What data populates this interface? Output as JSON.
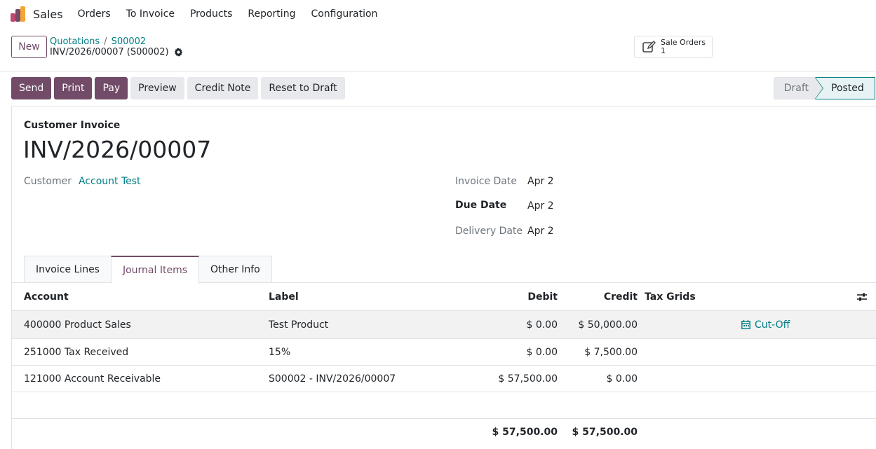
{
  "nav": {
    "brand": "Sales",
    "items": [
      "Orders",
      "To Invoice",
      "Products",
      "Reporting",
      "Configuration"
    ]
  },
  "control": {
    "new_label": "New",
    "breadcrumb": [
      "Quotations",
      "S00002"
    ],
    "record_title": "INV/2026/00007 (S00002)",
    "smart_button": {
      "label": "Sale Orders",
      "count": "1"
    }
  },
  "actions": {
    "send": "Send",
    "print": "Print",
    "pay": "Pay",
    "preview": "Preview",
    "credit_note": "Credit Note",
    "reset_to_draft": "Reset to Draft"
  },
  "status": {
    "steps": [
      "Draft",
      "Posted"
    ],
    "current": "Posted"
  },
  "invoice": {
    "type": "Customer Invoice",
    "name": "INV/2026/00007",
    "customer_label": "Customer",
    "customer_value": "Account Test",
    "invoice_date_label": "Invoice Date",
    "invoice_date_value": "Apr 2",
    "due_date_label": "Due Date",
    "due_date_value": "Apr 2",
    "delivery_date_label": "Delivery Date",
    "delivery_date_value": "Apr 2"
  },
  "tabs": [
    "Invoice Lines",
    "Journal Items",
    "Other Info"
  ],
  "active_tab": "Journal Items",
  "table": {
    "headers": {
      "account": "Account",
      "label": "Label",
      "debit": "Debit",
      "credit": "Credit",
      "tax_grids": "Tax Grids"
    },
    "rows": [
      {
        "account": "400000 Product Sales",
        "label": "Test Product",
        "debit": "$ 0.00",
        "credit": "$ 50,000.00",
        "cutoff": "Cut-Off"
      },
      {
        "account": "251000 Tax Received",
        "label": "15%",
        "debit": "$ 0.00",
        "credit": "$ 7,500.00"
      },
      {
        "account": "121000 Account Receivable",
        "label": "S00002 - INV/2026/00007",
        "debit": "$ 57,500.00",
        "credit": "$ 0.00"
      }
    ],
    "totals": {
      "debit": "$ 57,500.00",
      "credit": "$ 57,500.00"
    }
  },
  "colors": {
    "primary": "#714B67",
    "link": "#017e84"
  }
}
